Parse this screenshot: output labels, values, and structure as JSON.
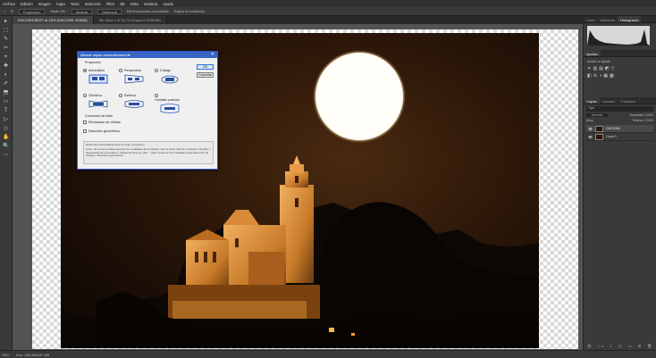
{
  "menubar": {
    "items": [
      "Archivo",
      "Edición",
      "Imagen",
      "Capa",
      "Texto",
      "Selección",
      "Filtro",
      "3D",
      "Vista",
      "Ventana",
      "Ayuda"
    ]
  },
  "optionsbar": {
    "mode": "Proyección",
    "transform_label": "Modo 3D:",
    "field1": "Mostrar",
    "field2": "Distancia",
    "field3": "Elimina píxeles recortados",
    "field4": "Sujeto al contenido"
  },
  "tabs": [
    {
      "label": "DSC1063-BEST al 16% (DSC1090, RGB/8)"
    },
    {
      "label": "Sin título-1 al 16,7% (Capa 0, RGB/8#)"
    }
  ],
  "tools": [
    "▸",
    "⬚",
    "✎",
    "✂",
    "⌖",
    "✚",
    "◐",
    "✐",
    "⬒",
    "▭",
    "T",
    "▷",
    "◇",
    "✋",
    "🔍",
    "⋯"
  ],
  "dialog": {
    "title": "Alinear capas automáticamente",
    "close": "✕",
    "projection_label": "Proyección",
    "options": [
      {
        "label": "Automática",
        "selected": true
      },
      {
        "label": "Perspectiva",
        "selected": false
      },
      {
        "label": "Collage",
        "selected": false
      },
      {
        "label": "Cilíndrica",
        "selected": false
      },
      {
        "label": "Esférica",
        "selected": false
      },
      {
        "label": "Cambiar posición",
        "selected": false
      }
    ],
    "ok": "OK",
    "cancel": "Cancelar",
    "lens_label": "Corrección de lente",
    "vignette": "Eliminación de viñetas",
    "distortion": "Distorsión geométrica",
    "description": "Determinar automáticamente la mejor proyección.",
    "description2": "Aviso: No se han podido detectar los metadatos de la cámara. Use la secuencia de comandos \"Perfiles > Secuencias de comandos > Cargar archivos en pila...\" para conservar los metadatos para detección de viñetas y distorsión geométrica."
  },
  "status": {
    "zoom": "16%",
    "doc": "Doc: 140,9M/187,8M"
  },
  "panels": {
    "top_tabs": [
      "Color",
      "Muestras",
      "Histograma"
    ],
    "adjust_tabs": [
      "Ajustes"
    ],
    "adjust_label": "Añadir un ajuste",
    "layers_tabs": [
      "Capas",
      "Canales",
      "Trazados"
    ],
    "kind": "Tipo",
    "blend": "Normal",
    "opacity_label": "Opacidad:",
    "opacity": "100%",
    "lock_label": "Bloq.:",
    "fill_label": "Relleno:",
    "fill": "100%",
    "layers": [
      {
        "name": "DSC1090",
        "active": true
      },
      {
        "name": "Capa 0",
        "active": false
      }
    ]
  },
  "colors": {
    "ui_dark": "#323232",
    "ui_mid": "#3a3a3a",
    "accent": "#3766c4",
    "moon": "#fffdf5",
    "stone": "#c98030"
  }
}
